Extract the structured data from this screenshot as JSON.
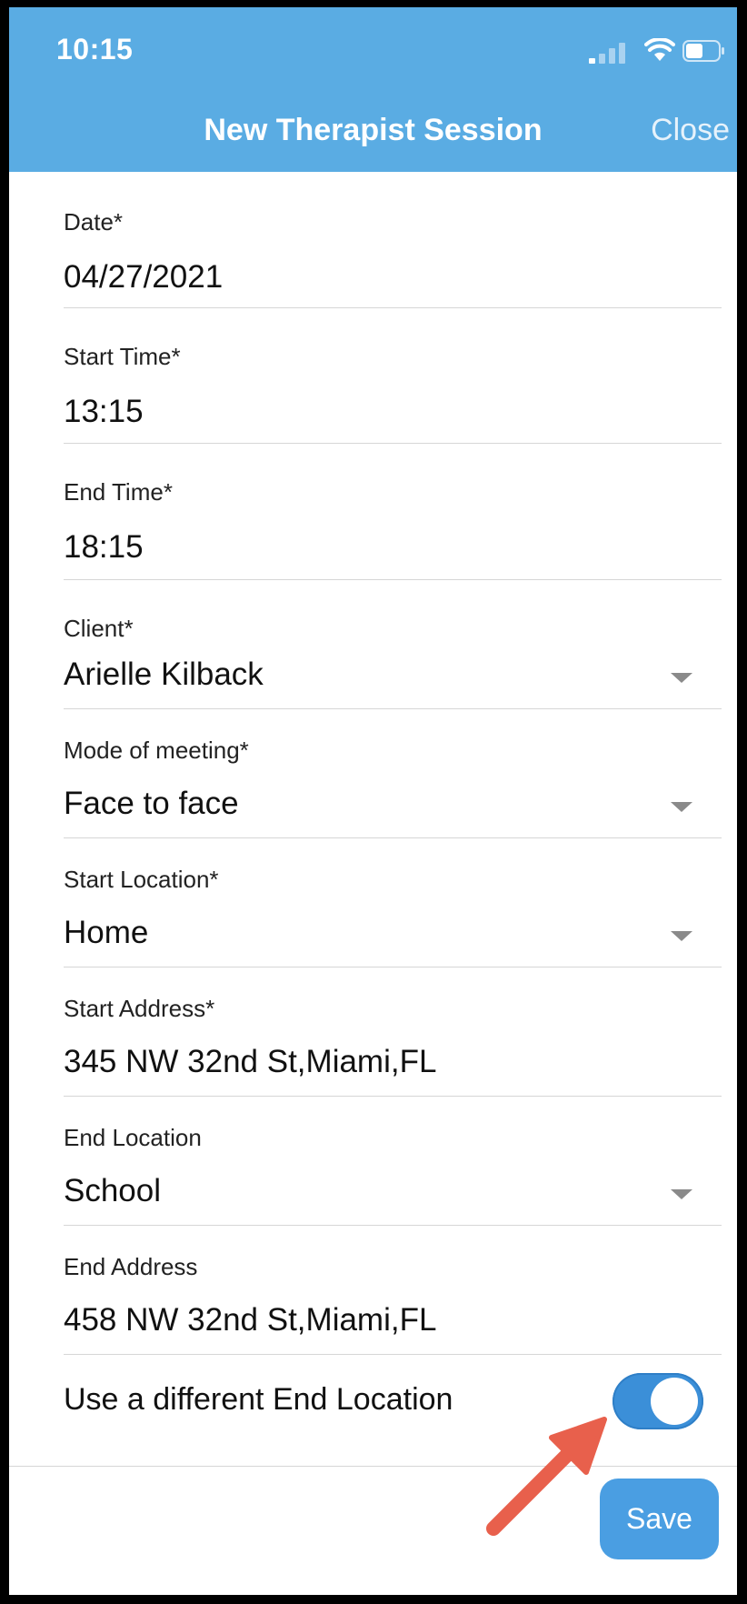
{
  "status_bar": {
    "time": "10:15"
  },
  "header": {
    "title": "New Therapist Session",
    "close_label": "Close"
  },
  "fields": [
    {
      "label": "Date*",
      "value": "04/27/2021",
      "dropdown": false
    },
    {
      "label": "Start Time*",
      "value": "13:15",
      "dropdown": false
    },
    {
      "label": "End Time*",
      "value": "18:15",
      "dropdown": false
    },
    {
      "label": "Client*",
      "value": "Arielle Kilback",
      "dropdown": true
    },
    {
      "label": "Mode of meeting*",
      "value": "Face to face",
      "dropdown": true
    },
    {
      "label": "Start Location*",
      "value": "Home",
      "dropdown": true
    },
    {
      "label": "Start Address*",
      "value": "345 NW 32nd St,Miami,FL",
      "dropdown": false
    },
    {
      "label": "End Location",
      "value": "School",
      "dropdown": true
    },
    {
      "label": "End Address",
      "value": "458 NW 32nd St,Miami,FL",
      "dropdown": false
    }
  ],
  "toggle": {
    "label": "Use a different End Location",
    "on": true
  },
  "footer": {
    "save_label": "Save"
  },
  "colors": {
    "header_bg": "#5aace3",
    "accent": "#4a9ee2",
    "toggle_on": "#3b8fd8",
    "annotation_arrow": "#e8604c"
  },
  "icons": {
    "signal": "cellular-signal-icon",
    "wifi": "wifi-icon",
    "battery": "battery-icon",
    "dropdown": "chevron-down-icon",
    "annotation": "arrow-annotation-icon"
  }
}
